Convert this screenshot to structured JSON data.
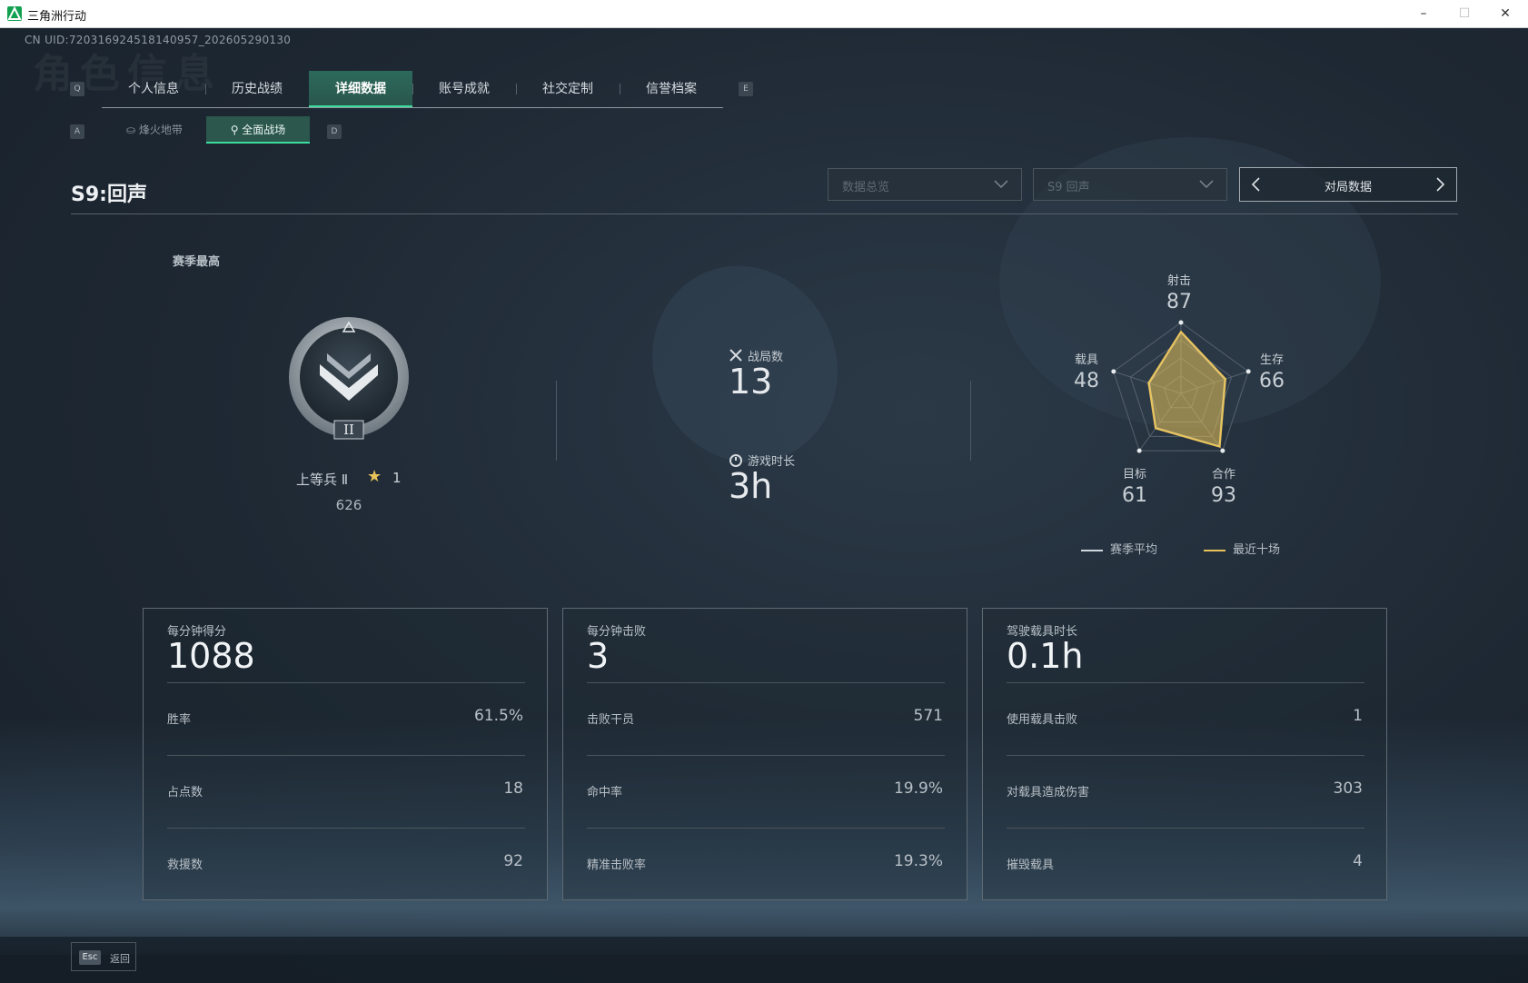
{
  "window": {
    "title": "三角洲行动",
    "min": "–",
    "max": "☐",
    "close": "✕"
  },
  "uid": "CN UID:720316924518140957_202605290130",
  "bg_title": "角色信息",
  "tab_keys": {
    "left": "Q",
    "right": "E"
  },
  "tabs": [
    "个人信息",
    "历史战绩",
    "详细数据",
    "账号成就",
    "社交定制",
    "信誉档案"
  ],
  "active_tab": "详细数据",
  "subtab_keys": {
    "left": "A",
    "right": "D"
  },
  "subtabs": [
    {
      "label": "烽火地带",
      "icon": "outpost-icon"
    },
    {
      "label": "全面战场",
      "icon": "battlefield-icon"
    }
  ],
  "active_subtab": "全面战场",
  "season": {
    "title": "S9:回声"
  },
  "filters": {
    "view": "数据总览",
    "season": "S9 回声",
    "match_button": "对局数据"
  },
  "peak": {
    "label": "赛季最高",
    "rank_name": "上等兵 Ⅱ",
    "rank_roman": "II",
    "stars": "1",
    "score": "626"
  },
  "summary": {
    "matches_label": "战局数",
    "matches_value": "13",
    "playtime_label": "游戏时长",
    "playtime_value": "3h"
  },
  "radar": {
    "axes": [
      {
        "name": "射击",
        "value": "87"
      },
      {
        "name": "生存",
        "value": "66"
      },
      {
        "name": "合作",
        "value": "93"
      },
      {
        "name": "目标",
        "value": "61"
      },
      {
        "name": "载具",
        "value": "48"
      }
    ],
    "recent_values": [
      87,
      66,
      93,
      61,
      48
    ],
    "average_values": [
      86,
      65,
      92,
      60,
      47
    ],
    "max": 100,
    "legend": {
      "average": "赛季平均",
      "recent": "最近十场"
    },
    "colors": {
      "average": "#cfd6dc",
      "recent": "#e8c35a",
      "grid": "#55616b"
    }
  },
  "cards": [
    {
      "title": "每分钟得分",
      "value": "1088",
      "rows": [
        {
          "label": "胜率",
          "value": "61.5%"
        },
        {
          "label": "占点数",
          "value": "18"
        },
        {
          "label": "救援数",
          "value": "92"
        }
      ]
    },
    {
      "title": "每分钟击败",
      "value": "3",
      "rows": [
        {
          "label": "击败干员",
          "value": "571"
        },
        {
          "label": "命中率",
          "value": "19.9%"
        },
        {
          "label": "精准击败率",
          "value": "19.3%"
        }
      ]
    },
    {
      "title": "驾驶载具时长",
      "value": "0.1h",
      "rows": [
        {
          "label": "使用载具击败",
          "value": "1"
        },
        {
          "label": "对载具造成伤害",
          "value": "303"
        },
        {
          "label": "摧毁载具",
          "value": "4"
        }
      ]
    }
  ],
  "footer": {
    "esc_key": "Esc",
    "back_label": "返回"
  },
  "colors": {
    "accent": "#3bdc9e",
    "active_tab_bg": "#2a5c50",
    "star": "#e8c35a"
  }
}
